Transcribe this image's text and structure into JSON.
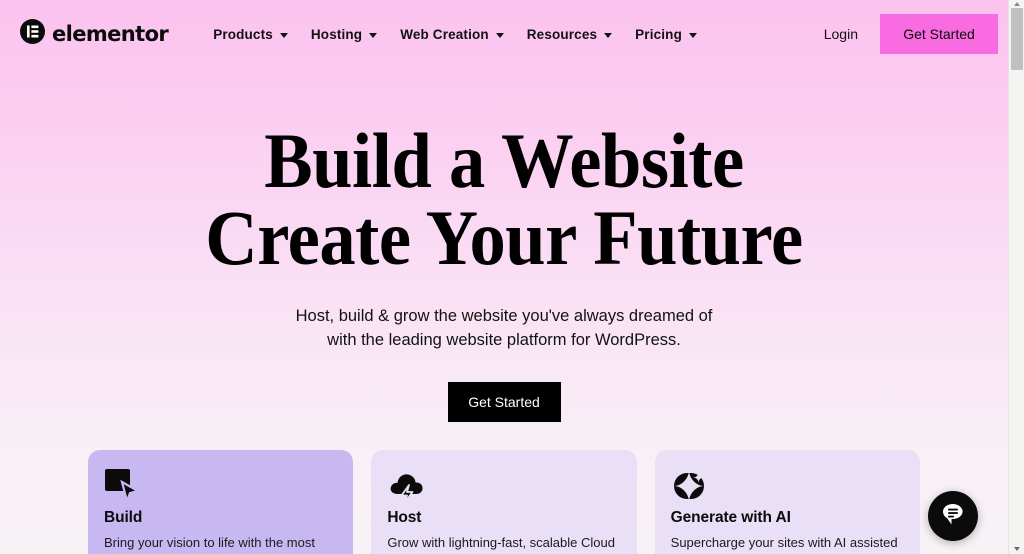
{
  "navbar": {
    "brand": {
      "icon": "elementor-logo-icon",
      "word": "elementor"
    },
    "items": [
      {
        "label": "Products",
        "caret": "chevron-down-icon"
      },
      {
        "label": "Hosting",
        "caret": "chevron-down-icon"
      },
      {
        "label": "Web Creation",
        "caret": "chevron-down-icon"
      },
      {
        "label": "Resources",
        "caret": "chevron-down-icon"
      },
      {
        "label": "Pricing",
        "caret": "chevron-down-icon"
      }
    ],
    "login_label": "Login",
    "cta_label": "Get Started",
    "cta_color": "#f96be0"
  },
  "hero": {
    "headline_line1": "Build a Website",
    "headline_line2": "Create Your Future",
    "subhead_line1": "Host, build & grow the website you've always dreamed of",
    "subhead_line2": "with the leading website platform for WordPress.",
    "cta_label": "Get Started",
    "cta_color": "#000000"
  },
  "cards": [
    {
      "icon": "cursor-square-icon",
      "title": "Build",
      "desc": "Bring your vision to life with the most",
      "bg": "#c8b8f2"
    },
    {
      "icon": "cloud-lightning-icon",
      "title": "Host",
      "desc": "Grow with lightning-fast, scalable Cloud",
      "bg": "#e9dff6"
    },
    {
      "icon": "ai-sparkle-icon",
      "title": "Generate with AI",
      "desc": "Supercharge your sites with AI assisted",
      "bg": "#e9dff6"
    }
  ],
  "chat_widget": {
    "icon": "chat-bubble-icon"
  },
  "scrollbar": {
    "position": "top"
  }
}
